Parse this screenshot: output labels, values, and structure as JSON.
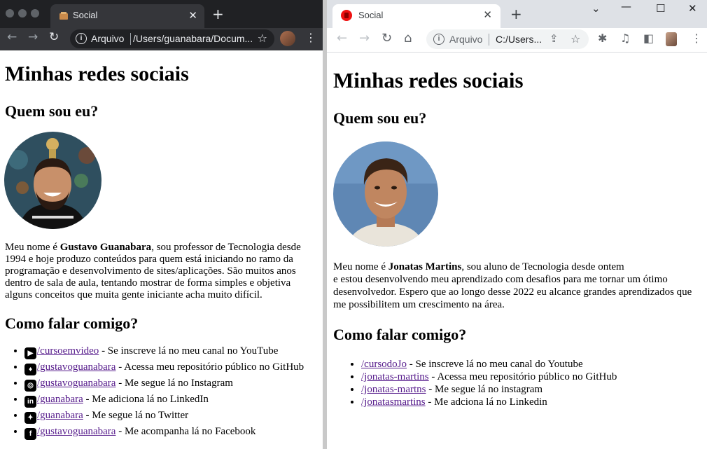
{
  "left_window": {
    "tab": {
      "title": "Social"
    },
    "address": {
      "label": "Arquivo",
      "url": "/Users/guanabara/Docum..."
    },
    "page": {
      "title": "Minhas redes sociais",
      "about_heading": "Quem sou eu?",
      "bio": {
        "before": "Meu nome é ",
        "name": "Gustavo Guanabara",
        "after": ", sou professor de Tecnologia desde 1994 e hoje produzo conteúdos para quem está iniciando no ramo da programação e desenvolvimento de sites/aplicações. São muitos anos dentro de sala de aula, tentando mostrar de forma simples e objetiva alguns conceitos que muita gente iniciante acha muito difícil."
      },
      "contact_heading": "Como falar comigo?",
      "links": [
        {
          "icon": "youtube-icon",
          "link": "/cursoemvideo",
          "desc": " - Se inscreve lá no meu canal no YouTube"
        },
        {
          "icon": "github-icon",
          "link": "/gustavoguanabara",
          "desc": " - Acessa meu repositório público no GitHub"
        },
        {
          "icon": "instagram-icon",
          "link": "/gustavoguanabara",
          "desc": " - Me segue lá no Instagram"
        },
        {
          "icon": "linkedin-icon",
          "link": "/guanabara",
          "desc": " - Me adiciona lá no LinkedIn"
        },
        {
          "icon": "twitter-icon",
          "link": "/guanabara",
          "desc": " - Me segue lá no Twitter"
        },
        {
          "icon": "facebook-icon",
          "link": "/gustavoguanabara",
          "desc": " - Me acompanha lá no Facebook"
        }
      ]
    }
  },
  "right_window": {
    "tab": {
      "title": "Social"
    },
    "address": {
      "label": "Arquivo",
      "url": "C:/Users..."
    },
    "page": {
      "title": "Minhas redes sociais",
      "about_heading": "Quem sou eu?",
      "bio": {
        "before": "Meu nome é ",
        "name": "Jonatas Martins",
        "after_line1": ", sou aluno de Tecnologia desde ontem",
        "after_rest": "e estou desenvolvendo meu aprendizado com desafios para me tornar um ótimo desenvolvedor. Espero que ao longo desse 2022 eu alcance grandes aprendizados que me possibilitem um crescimento na área."
      },
      "contact_heading": "Como falar comigo?",
      "links": [
        {
          "link": "/cursodoJo",
          "desc": " - Se inscreve lá no meu canal do Youtube"
        },
        {
          "link": "/jonatas-martins",
          "desc": " - Acessa meu repositório público no GitHub"
        },
        {
          "link": "/jonatas-martns",
          "desc": " - Me segue lá no instagram"
        },
        {
          "link": "/jonatasmartins",
          "desc": " - Me adciona lá no Linkedin"
        }
      ]
    }
  },
  "colors": {
    "link_visited": "#551a8b",
    "link_unvisited": "#1a0dab",
    "dark_chrome": "#202124",
    "light_chrome": "#dee1e6"
  }
}
